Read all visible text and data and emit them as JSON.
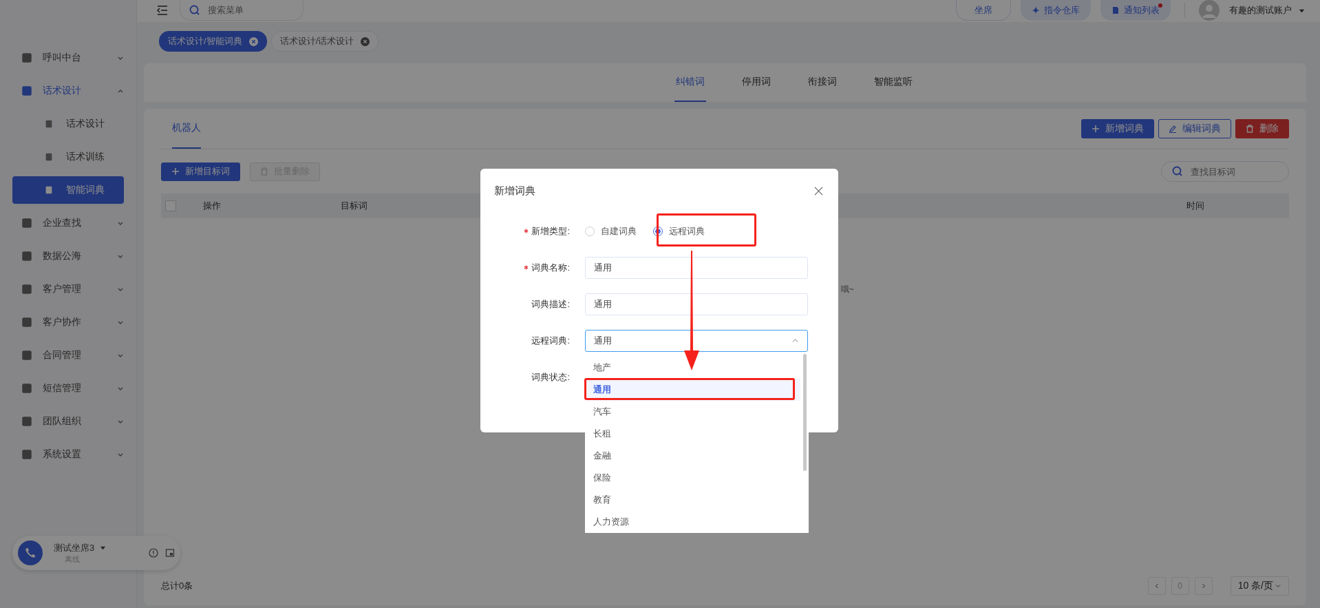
{
  "header": {
    "search_placeholder": "搜索菜单",
    "buttons": [
      {
        "label": "坐席",
        "kind": "plain",
        "dot": false
      },
      {
        "label": "指令仓库",
        "kind": "pin",
        "dot": false
      },
      {
        "label": "通知列表",
        "kind": "note",
        "dot": true
      }
    ],
    "user": "有趣的测试账户"
  },
  "tags": [
    {
      "label": "话术设计/智能词典",
      "selected": true
    },
    {
      "label": "话术设计/话术设计",
      "selected": false
    }
  ],
  "sidebar": {
    "items": [
      {
        "label": "呼叫中台",
        "expanded": false,
        "selected": false
      },
      {
        "label": "话术设计",
        "expanded": true,
        "selected": true,
        "children": [
          {
            "label": "话术设计",
            "selected": false
          },
          {
            "label": "话术训练",
            "selected": false
          },
          {
            "label": "智能词典",
            "selected": true
          }
        ]
      },
      {
        "label": "企业查找",
        "expanded": false,
        "selected": false
      },
      {
        "label": "数据公海",
        "expanded": false,
        "selected": false
      },
      {
        "label": "客户管理",
        "expanded": false,
        "selected": false
      },
      {
        "label": "客户协作",
        "expanded": false,
        "selected": false
      },
      {
        "label": "合同管理",
        "expanded": false,
        "selected": false
      },
      {
        "label": "短信管理",
        "expanded": false,
        "selected": false
      },
      {
        "label": "团队组织",
        "expanded": false,
        "selected": false
      },
      {
        "label": "系统设置",
        "expanded": false,
        "selected": false
      }
    ]
  },
  "agent": {
    "name": "测试坐席3",
    "status": "离线"
  },
  "tabs": [
    {
      "label": "纠错词",
      "selected": true
    },
    {
      "label": "停用词",
      "selected": false
    },
    {
      "label": "衔接词",
      "selected": false
    },
    {
      "label": "智能监听",
      "selected": false
    }
  ],
  "subtabs": [
    {
      "label": "机器人",
      "selected": true
    }
  ],
  "actions": [
    {
      "label": "新增词典",
      "kind": "primary"
    },
    {
      "label": "编辑词典",
      "kind": "outline"
    },
    {
      "label": "删除",
      "kind": "danger"
    }
  ],
  "toolbar": {
    "add": {
      "label": "新增目标词",
      "disabled": false
    },
    "batch_delete": {
      "label": "批量删除",
      "disabled": true
    },
    "search_placeholder": "查找目标词"
  },
  "table": {
    "select_all": {
      "checked": false
    },
    "columns": [
      "操作",
      "目标词",
      "时间"
    ],
    "empty_text": "哦~"
  },
  "footer": {
    "total": "总计0条",
    "page": "0",
    "page_size": "10 条/页"
  },
  "dialog": {
    "title": "新增词典",
    "type": {
      "label": "新增类型:",
      "required": true,
      "options": [
        {
          "label": "自建词典",
          "selected": false
        },
        {
          "label": "远程词典",
          "selected": true
        }
      ]
    },
    "name": {
      "label": "词典名称:",
      "required": true,
      "value": "通用"
    },
    "description": {
      "label": "词典描述:",
      "required": false,
      "value": "通用"
    },
    "remote": {
      "label": "远程词典:",
      "required": false,
      "value": "通用",
      "expanded": true
    },
    "status": {
      "label": "词典状态:",
      "required": false
    }
  },
  "dropdown": [
    {
      "label": "地产",
      "selected": false
    },
    {
      "label": "通用",
      "selected": true
    },
    {
      "label": "汽车",
      "selected": false
    },
    {
      "label": "长租",
      "selected": false
    },
    {
      "label": "金融",
      "selected": false
    },
    {
      "label": "保险",
      "selected": false
    },
    {
      "label": "教育",
      "selected": false
    },
    {
      "label": "人力资源",
      "selected": false
    }
  ]
}
